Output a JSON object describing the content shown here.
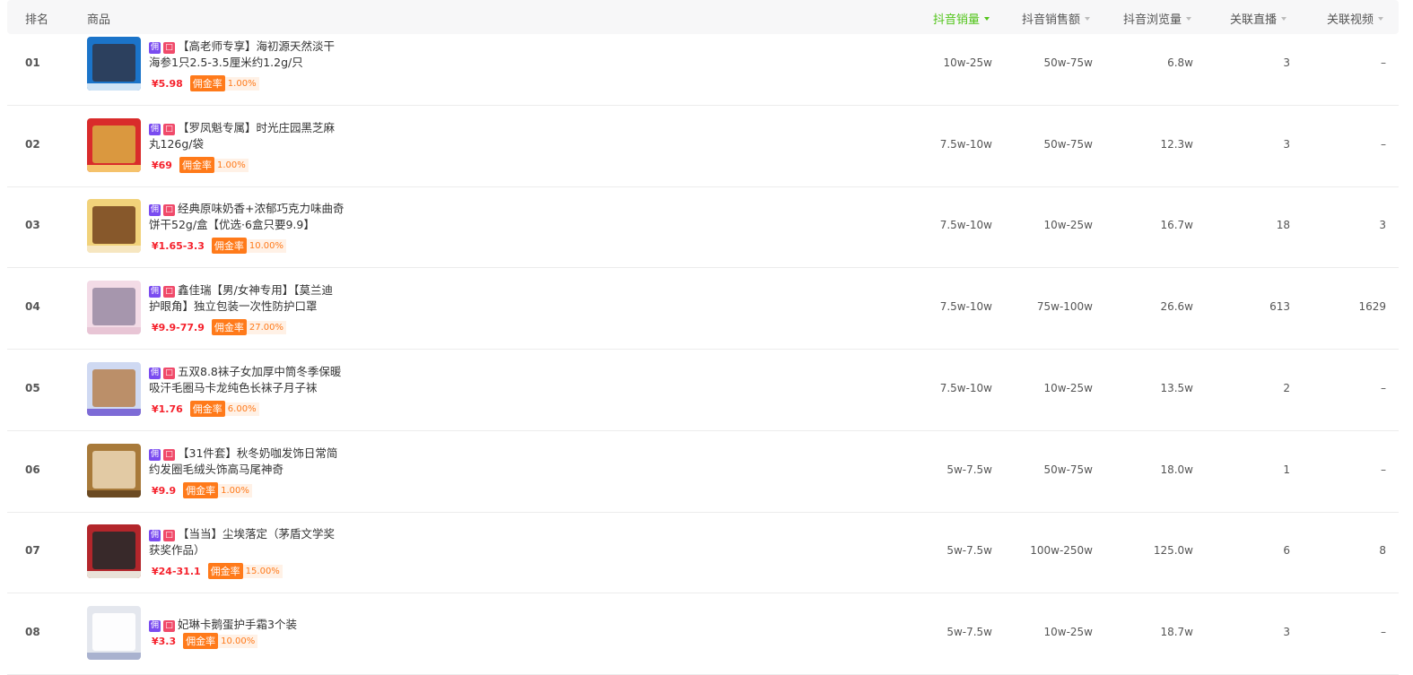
{
  "columns": {
    "rank": "排名",
    "product": "商品",
    "sales": "抖音销量",
    "revenue": "抖音销售额",
    "views": "抖音浏览量",
    "live": "关联直播",
    "video": "关联视频"
  },
  "tags": {
    "yong": "佣",
    "shop": "□"
  },
  "commission_label": "佣金率",
  "sorted_column_color": "#52c41a",
  "rows": [
    {
      "rank": "01",
      "title1": "【高老师专享】海初源天然淡干",
      "title2": "海参1只2.5-3.5厘米约1.2g/只",
      "price": "¥5.98",
      "rate": "1.00%",
      "sales": "10w-25w",
      "revenue": "50w-75w",
      "views": "6.8w",
      "live": "3",
      "video": "–",
      "thumb": [
        "#1b74c9",
        "#2f3b52",
        "#cfe3f5"
      ]
    },
    {
      "rank": "02",
      "title1": "【罗凤魁专属】时光庄园黑芝麻",
      "title2": "丸126g/袋",
      "price": "¥69",
      "rate": "1.00%",
      "sales": "7.5w-10w",
      "revenue": "50w-75w",
      "views": "12.3w",
      "live": "3",
      "video": "–",
      "thumb": [
        "#d92b2b",
        "#d9a441",
        "#f5c26b"
      ]
    },
    {
      "rank": "03",
      "title1": "经典原味奶香+浓郁巧克力味曲奇",
      "title2": "饼干52g/盒【优选·6盒只要9.9】",
      "price": "¥1.65-3.3",
      "rate": "10.00%",
      "sales": "7.5w-10w",
      "revenue": "10w-25w",
      "views": "16.7w",
      "live": "18",
      "video": "3",
      "thumb": [
        "#f1d27a",
        "#7b4a22",
        "#f6e6c0"
      ]
    },
    {
      "rank": "04",
      "title1": "鑫佳瑞【男/女神专用】【莫兰迪",
      "title2": "护眼角】独立包装一次性防护口罩",
      "price": "¥9.9-77.9",
      "rate": "27.00%",
      "sales": "7.5w-10w",
      "revenue": "75w-100w",
      "views": "26.6w",
      "live": "613",
      "video": "1629",
      "thumb": [
        "#f3dbe6",
        "#9d8ea6",
        "#e8c5d5"
      ]
    },
    {
      "rank": "05",
      "title1": "五双8.8袜子女加厚中筒冬季保暖",
      "title2": "吸汗毛圈马卡龙纯色长袜子月子袜",
      "price": "¥1.76",
      "rate": "6.00%",
      "sales": "7.5w-10w",
      "revenue": "10w-25w",
      "views": "13.5w",
      "live": "2",
      "video": "–",
      "thumb": [
        "#cfd9f2",
        "#b8865a",
        "#7d6bd6"
      ]
    },
    {
      "rank": "06",
      "title1": "【31件套】秋冬奶咖发饰日常简",
      "title2": "约发圈毛绒头饰高马尾神奇",
      "price": "¥9.9",
      "rate": "1.00%",
      "sales": "5w-7.5w",
      "revenue": "50w-75w",
      "views": "18.0w",
      "live": "1",
      "video": "–",
      "thumb": [
        "#a87a3a",
        "#e8d3b0",
        "#6b4a22"
      ]
    },
    {
      "rank": "07",
      "title1": "【当当】尘埃落定（茅盾文学奖",
      "title2": "获奖作品）",
      "price": "¥24-31.1",
      "rate": "15.00%",
      "sales": "5w-7.5w",
      "revenue": "100w-250w",
      "views": "125.0w",
      "live": "6",
      "video": "8",
      "thumb": [
        "#b3262b",
        "#2a2a2a",
        "#e9e2d8"
      ]
    },
    {
      "rank": "08",
      "title1": "妃琳卡鹅蛋护手霜3个装",
      "title2": "",
      "price": "¥3.3",
      "rate": "10.00%",
      "sales": "5w-7.5w",
      "revenue": "10w-25w",
      "views": "18.7w",
      "live": "3",
      "video": "–",
      "thumb": [
        "#e4e7ee",
        "#ffffff",
        "#a9b2cf"
      ]
    }
  ]
}
